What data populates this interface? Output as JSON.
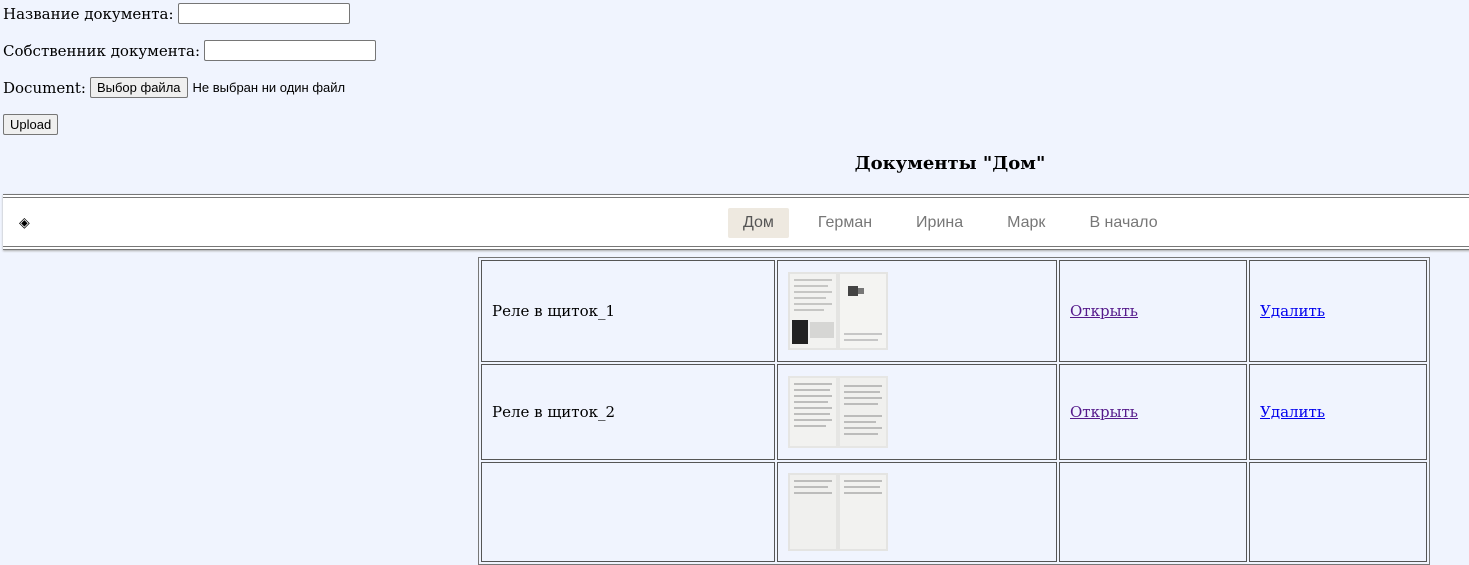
{
  "form": {
    "title_label": "Название документа:",
    "title_value": "",
    "owner_label": "Собственник документа:",
    "owner_value": "",
    "file_label": "Document:",
    "file_button": "Выбор файла",
    "file_status": "Не выбран ни один файл",
    "upload_button": "Upload"
  },
  "heading": "Документы \"Дом\"",
  "navbar": {
    "brand_icon": "◈",
    "items": [
      {
        "label": "Дом",
        "active": true
      },
      {
        "label": "Герман",
        "active": false
      },
      {
        "label": "Ирина",
        "active": false
      },
      {
        "label": "Марк",
        "active": false
      },
      {
        "label": "В начало",
        "active": false
      }
    ]
  },
  "documents": [
    {
      "name": "Реле в щиток_1",
      "open": "Открыть",
      "delete": "Удалить"
    },
    {
      "name": "Реле в щиток_2",
      "open": "Открыть",
      "delete": "Удалить"
    },
    {
      "name": "",
      "open": "",
      "delete": ""
    }
  ]
}
